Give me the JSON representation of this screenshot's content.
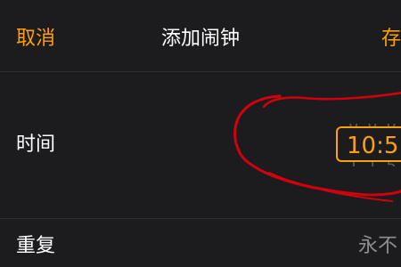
{
  "navbar": {
    "cancel_label": "取消",
    "title": "添加闹钟",
    "save_label": "存"
  },
  "time_row": {
    "label": "时间",
    "value": "10:5",
    "ghost_top": "0 0 0 0",
    "ghost_bottom": "1 1 5 0"
  },
  "repeat_row": {
    "label": "重复",
    "value": "永不"
  },
  "colors": {
    "accent": "#ff9f0a",
    "background": "#000000",
    "cell": "#1c1c1e",
    "secondary_text": "#8e8e93",
    "annotation": "#d0000d"
  }
}
